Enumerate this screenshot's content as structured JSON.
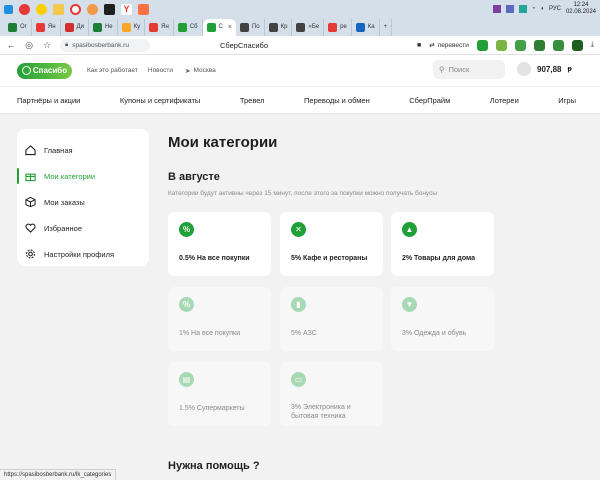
{
  "browser": {
    "tabs": [
      {
        "label": "Ог",
        "favicon_color": "#1e7d37"
      },
      {
        "label": "Ян",
        "favicon_color": "#e53935"
      },
      {
        "label": "Ди",
        "favicon_color": "#d32f2f"
      },
      {
        "label": "Не",
        "favicon_color": "#1e7d37"
      },
      {
        "label": "Ку",
        "favicon_color": "#f9a825"
      },
      {
        "label": "Ян",
        "favicon_color": "#e53935"
      },
      {
        "label": "Сб",
        "favicon_color": "#21a038"
      },
      {
        "label": "С",
        "favicon_color": "#21a038"
      },
      {
        "label": "По",
        "favicon_color": "#424242"
      },
      {
        "label": "Кр",
        "favicon_color": "#424242"
      },
      {
        "label": "«Бе",
        "favicon_color": "#424242"
      },
      {
        "label": "ре",
        "favicon_color": "#e53935"
      },
      {
        "label": "Ка",
        "favicon_color": "#1565c0"
      }
    ],
    "lang": "РУС",
    "time": "12:24",
    "date": "02.08.2024",
    "url": "spasibosberbank.ru",
    "page_title": "СберСпасибо",
    "translate_label": "перевести",
    "status_url": "https://spasibosberbank.ru/lk_categories"
  },
  "header": {
    "logo_text": "Спасибо",
    "links": [
      "Как это работает",
      "Новости"
    ],
    "city": "Москва",
    "search_placeholder": "Поиск",
    "balance": "907,88"
  },
  "nav": [
    "Партнёры и акции",
    "Купоны и сертификаты",
    "Тревел",
    "Переводы и обмен",
    "СберПрайм",
    "Лотереи",
    "Игры"
  ],
  "sidebar": {
    "items": [
      {
        "label": "Главная",
        "icon": "home-icon"
      },
      {
        "label": "Мои категории",
        "icon": "gift-icon",
        "active": true
      },
      {
        "label": "Мои заказы",
        "icon": "box-icon"
      },
      {
        "label": "Избранное",
        "icon": "heart-icon"
      },
      {
        "label": "Настройки профиля",
        "icon": "gear-icon"
      }
    ]
  },
  "main": {
    "title": "Мои категории",
    "section_title": "В августе",
    "section_note": "Категории будут активны через 15 минут, после этого за покупки можно получать бонусы",
    "cards": [
      {
        "label": "0.5% На все покупки",
        "icon": "percent-icon",
        "active": true
      },
      {
        "label": "5% Кафе и рестораны",
        "icon": "cutlery-icon",
        "active": true
      },
      {
        "label": "2% Товары для дома",
        "icon": "lamp-icon",
        "active": true
      },
      {
        "label": "1% На все покупки",
        "icon": "percent-icon",
        "active": false
      },
      {
        "label": "5% АЗС",
        "icon": "fuel-icon",
        "active": false
      },
      {
        "label": "3% Одежда и обувь",
        "icon": "shirt-icon",
        "active": false
      },
      {
        "label": "1.5% Супермаркеты",
        "icon": "basket-icon",
        "active": false
      },
      {
        "label": "3% Электроника и бытовая техника",
        "icon": "monitor-icon",
        "active": false
      }
    ],
    "help_title": "Нужна помощь ?"
  },
  "colors": {
    "brand_green": "#21a038",
    "light_green": "#a8d8b4",
    "page_bg": "#f2f2f2"
  }
}
